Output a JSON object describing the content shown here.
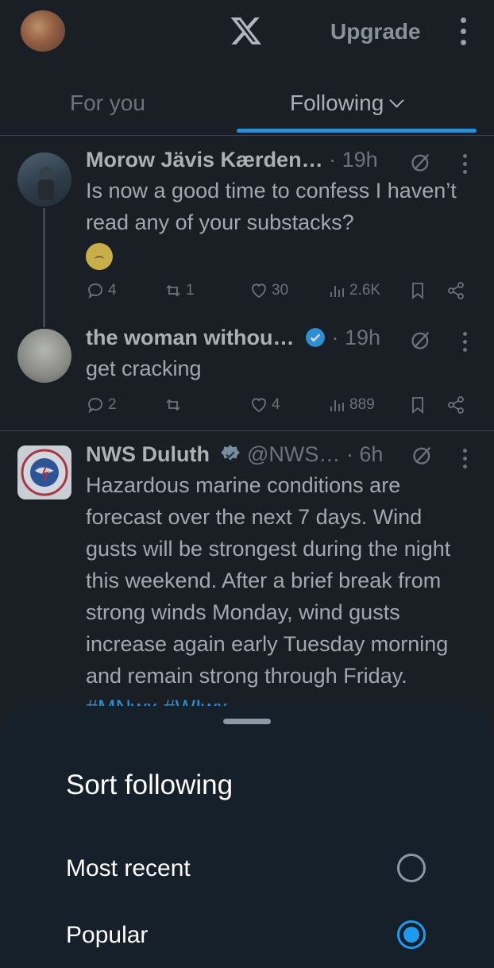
{
  "header": {
    "logo_icon": "x-logo-icon",
    "upgrade_label": "Upgrade",
    "more_icon": "more-vertical-icon"
  },
  "tabs": [
    {
      "label": "For you",
      "active": false
    },
    {
      "label": "Following",
      "active": true
    }
  ],
  "tweets": [
    {
      "name": "Morow Jävis Kærden…",
      "time": "· 19h",
      "text": "Is now a good time to confess I haven’t read any of your substacks?",
      "emoji": "weary-face-emoji",
      "replies": "4",
      "reposts": "1",
      "likes": "30",
      "views": "2.6K"
    },
    {
      "name": "the woman withou…",
      "verified": true,
      "time": "· 19h",
      "text": "get cracking",
      "replies": "2",
      "reposts": "",
      "likes": "4",
      "views": "889"
    },
    {
      "name": "NWS Duluth",
      "verified": true,
      "handle": "@NWS…",
      "time": "· 6h",
      "text": "Hazardous marine conditions are forecast over the next 7 days. Wind gusts will be strongest during the night this weekend. After a brief break from strong winds Monday, wind gusts increase again early Tuesday morning and remain strong through Friday.",
      "hashtags": "#MNwx #WIwx"
    }
  ],
  "sheet": {
    "title": "Sort following",
    "options": [
      {
        "label": "Most recent",
        "selected": false
      },
      {
        "label": "Popular",
        "selected": true
      }
    ]
  },
  "colors": {
    "accent": "#1d9bf0",
    "background": "#000000",
    "sheet_background": "#15202b"
  }
}
